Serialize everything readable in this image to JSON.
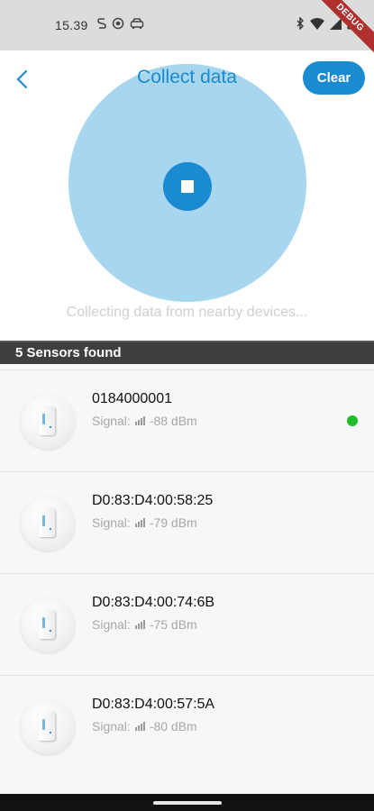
{
  "status_bar": {
    "time": "15.39",
    "left_icons": [
      "s-notification-icon",
      "record-icon",
      "car-icon"
    ],
    "right_icons": [
      "bluetooth-icon",
      "wifi-icon",
      "signal-icon",
      "battery-icon"
    ],
    "debug_label": "DEBUG"
  },
  "header": {
    "title": "Collect data",
    "clear_label": "Clear",
    "status_text": "Collecting data from nearby devices..."
  },
  "sensors": {
    "count_label": "5 Sensors found",
    "signal_label": "Signal:",
    "items": [
      {
        "name": "0184000001",
        "signal": "-88 dBm",
        "connected": true
      },
      {
        "name": "D0:83:D4:00:58:25",
        "signal": "-79 dBm",
        "connected": false
      },
      {
        "name": "D0:83:D4:00:74:6B",
        "signal": "-75 dBm",
        "connected": false
      },
      {
        "name": "D0:83:D4:00:57:5A",
        "signal": "-80 dBm",
        "connected": false
      }
    ]
  },
  "colors": {
    "accent": "#1a8bd0",
    "scan_circle": "#a8d6ee",
    "connected_dot": "#1fbf2a",
    "sensors_bar": "#3f3f3f"
  }
}
